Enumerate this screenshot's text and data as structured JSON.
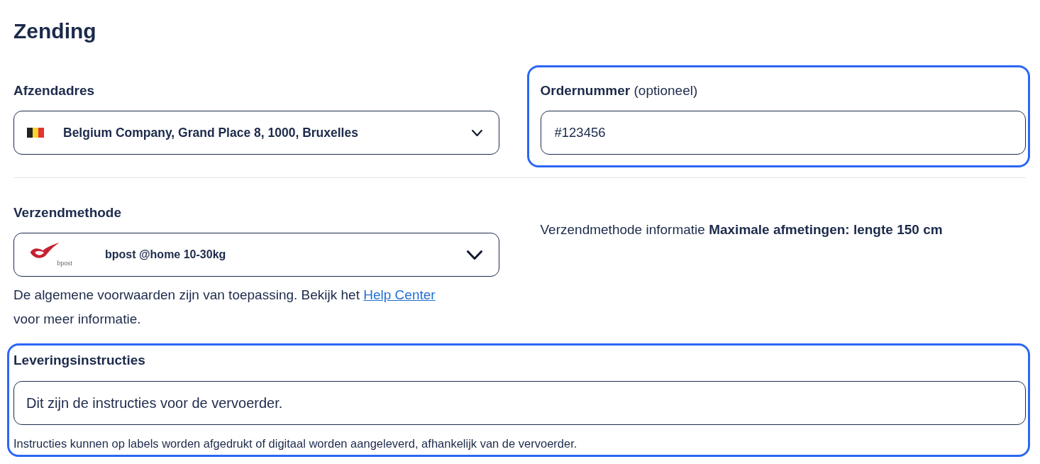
{
  "title": "Zending",
  "sender_address": {
    "label": "Afzendadres",
    "value": "Belgium Company, Grand Place 8, 1000, Bruxelles"
  },
  "order_number": {
    "label": "**Ordernummer** (optioneel)",
    "value": "#123456",
    "highlighted": true
  },
  "shipping_method": {
    "label": "Verzendmethode",
    "value": "bpost @home 10-30kg",
    "logo_text": "bpost",
    "terms": {
      "text": "De algemene voorwaarden zijn van toepassing. Bekijk het",
      "link": "Help Center",
      "after": "voor meer informatie."
    }
  },
  "shipping_info": {
    "text": "Verzendmethode informatie **Maximale afmetingen: lengte 150 cm**"
  },
  "delivery_instructions": {
    "label": "Leveringsinstructies",
    "value": "Dit zijn de instructies voor de vervoerder.",
    "hint": "Instructies kunnen op labels worden afgedrukt of digitaal worden aangeleverd, afhankelijk van de vervoerder.",
    "highlighted": true
  }
}
